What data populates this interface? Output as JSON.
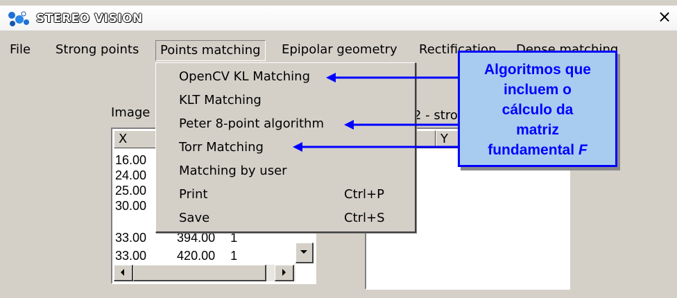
{
  "window": {
    "title": "STEREO VISION",
    "close_label": "×"
  },
  "menubar": {
    "items": [
      {
        "label": "File"
      },
      {
        "label": "Strong points"
      },
      {
        "label": "Points matching"
      },
      {
        "label": "Epipolar geometry"
      },
      {
        "label": "Rectification"
      },
      {
        "label": "Dense matching"
      }
    ]
  },
  "left_panel": {
    "label": "Image",
    "column_x": "X",
    "rows": [
      {
        "x": "16.00"
      },
      {
        "x": "24.00"
      },
      {
        "x": "25.00"
      },
      {
        "x": "30.00"
      },
      {
        "x": "33.00",
        "y": "394.00",
        "n": "1"
      },
      {
        "x": "33.00",
        "y": "420.00",
        "n": "1"
      }
    ]
  },
  "right_panel": {
    "label_fragment": "2 - stron",
    "column_y": "Y"
  },
  "dropdown": {
    "items": [
      {
        "label": "OpenCV KL Matching",
        "accel": ""
      },
      {
        "label": "KLT Matching",
        "accel": ""
      },
      {
        "label": "Peter 8-point algorithm",
        "accel": ""
      },
      {
        "label": "Torr Matching",
        "accel": ""
      },
      {
        "label": "Matching by user",
        "accel": ""
      },
      {
        "label": "Print",
        "accel": "Ctrl+P"
      },
      {
        "label": "Save",
        "accel": "Ctrl+S"
      }
    ]
  },
  "callout": {
    "lines": [
      "Algoritmos que",
      "incluem o",
      "cálculo da",
      "matriz",
      "fundamental"
    ],
    "symbol": "F"
  },
  "colors": {
    "arrow": "#0000ff",
    "callout_fill": "#a8ccf0",
    "window_bg": "#d4d0c8"
  },
  "icons": {
    "app": "stereo-vision-app-icon",
    "close": "close-icon",
    "scroll_down": "scroll-down-arrow-icon",
    "scroll_left": "scroll-left-arrow-icon",
    "scroll_right": "scroll-right-arrow-icon"
  }
}
